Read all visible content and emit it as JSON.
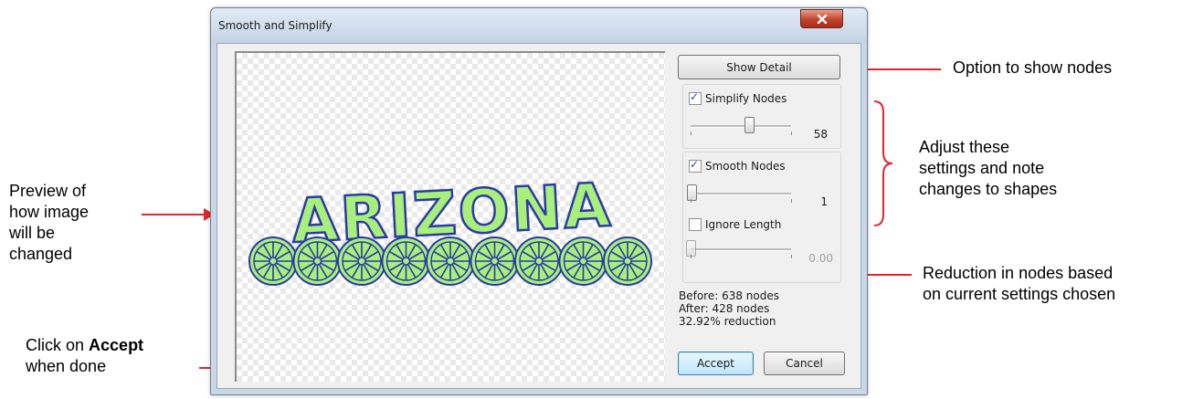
{
  "dialog": {
    "title": "Smooth and Simplify",
    "close_label": "x",
    "preview_text": "ARIZONA",
    "show_detail_label": "Show Detail",
    "simplify": {
      "label": "Simplify Nodes",
      "checked": true,
      "value": "58",
      "level": 0.58
    },
    "smooth": {
      "label": "Smooth Nodes",
      "checked": true,
      "value": "1",
      "level": 0.01
    },
    "ignore_length": {
      "label": "Ignore Length",
      "checked": false,
      "value": "0.00",
      "level": 0.0
    },
    "stats": {
      "before": "Before: 638 nodes",
      "after": "After: 428 nodes",
      "reduction": "32.92% reduction"
    },
    "accept_label": "Accept",
    "cancel_label": "Cancel"
  },
  "annotations": {
    "show_nodes": "Option to show nodes",
    "adjust": "Adjust these\nsettings and note\nchanges to shapes",
    "preview": "Preview of\nhow image\nwill be\nchanged",
    "reduction": "Reduction in nodes based\non current settings chosen",
    "click_on": "Click on ",
    "accept_word": "Accept",
    "when_done": "when done"
  },
  "colors": {
    "arrow": "#e3242b",
    "shape_fill": "#a8f07a",
    "shape_stroke": "#2c3aa8"
  }
}
